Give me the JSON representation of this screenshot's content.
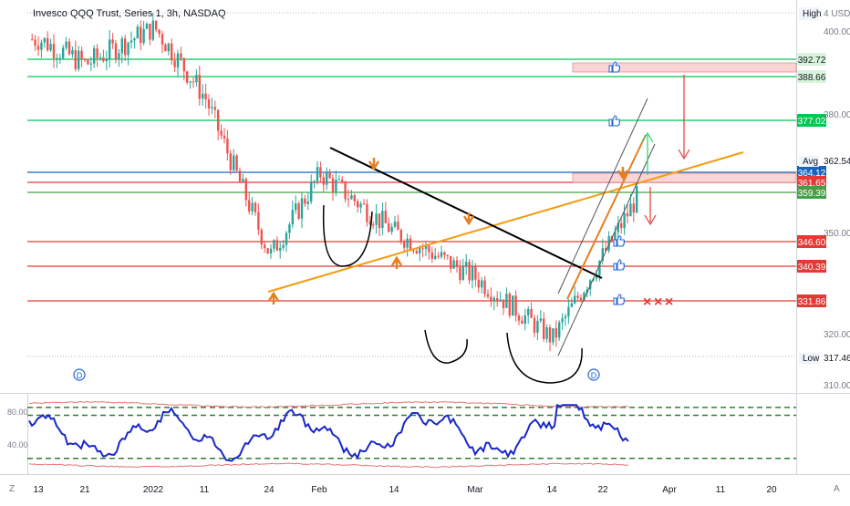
{
  "header": {
    "title": "Invesco QQQ Trust, Series 1, 3h, NASDAQ",
    "high_label": "High",
    "high_value": "4 USD"
  },
  "price_axis": {
    "ticks": [
      "400.00",
      "380.00",
      "350.00",
      "320.00",
      "310.00"
    ],
    "avg_label": "Avg",
    "avg_value": "362.54",
    "low_label": "Low",
    "low_value": "317.46"
  },
  "levels": [
    {
      "label": "392.72",
      "color": "#00c853",
      "fill": "#d8f5dc"
    },
    {
      "label": "388.66",
      "color": "#00c853",
      "fill": "#d8f5dc"
    },
    {
      "label": "377.02",
      "color": "#00c853",
      "fill": "#00c853"
    },
    {
      "label": "364.12",
      "color": "#1565c0",
      "fill": "#1565c0"
    },
    {
      "label": "361.65",
      "color": "#e53935",
      "fill": "#e53935"
    },
    {
      "label": "359.39",
      "color": "#43a047",
      "fill": "#43a047"
    },
    {
      "label": "346.60",
      "color": "#e53935",
      "fill": "#e53935"
    },
    {
      "label": "340.39",
      "color": "#e53935",
      "fill": "#e53935"
    },
    {
      "label": "331.86",
      "color": "#e53935",
      "fill": "#e53935"
    }
  ],
  "time_axis": {
    "labels": [
      "13",
      "21",
      "2022",
      "11",
      "24",
      "Feb",
      "14",
      "Mar",
      "14",
      "22",
      "Apr",
      "11",
      "20"
    ],
    "left_btn": "Z",
    "right_btn": "A"
  },
  "rsi": {
    "ticks": [
      "80.00",
      "40.00"
    ]
  },
  "markers": {
    "dividend": "D",
    "cross": "×"
  },
  "chart_data": {
    "type": "line",
    "symbol": "QQQ",
    "timeframe": "3h",
    "x": [
      "13",
      "21",
      "2022",
      "11",
      "24",
      "Feb",
      "14",
      "Mar",
      "14",
      "22"
    ],
    "ylim": [
      310,
      405
    ],
    "series": [
      {
        "values": [
          398,
          392,
          401,
          384,
          344,
          365,
          350,
          338,
          322,
          360
        ]
      }
    ],
    "horizontal_levels": [
      392.72,
      388.66,
      377.02,
      364.12,
      361.65,
      359.39,
      346.6,
      340.39,
      331.86
    ],
    "rsi_ylim": [
      0,
      100
    ],
    "rsi_levels": [
      85,
      75,
      20
    ]
  },
  "colors": {
    "up": "#26a69a",
    "down": "#ef5350",
    "rsi": "#1a28c8",
    "band": "#e57373",
    "trend_orange": "#f39c12",
    "trend_black": "#000000",
    "arrow_orange": "#e67e22",
    "thumb": "#1e63d6"
  }
}
